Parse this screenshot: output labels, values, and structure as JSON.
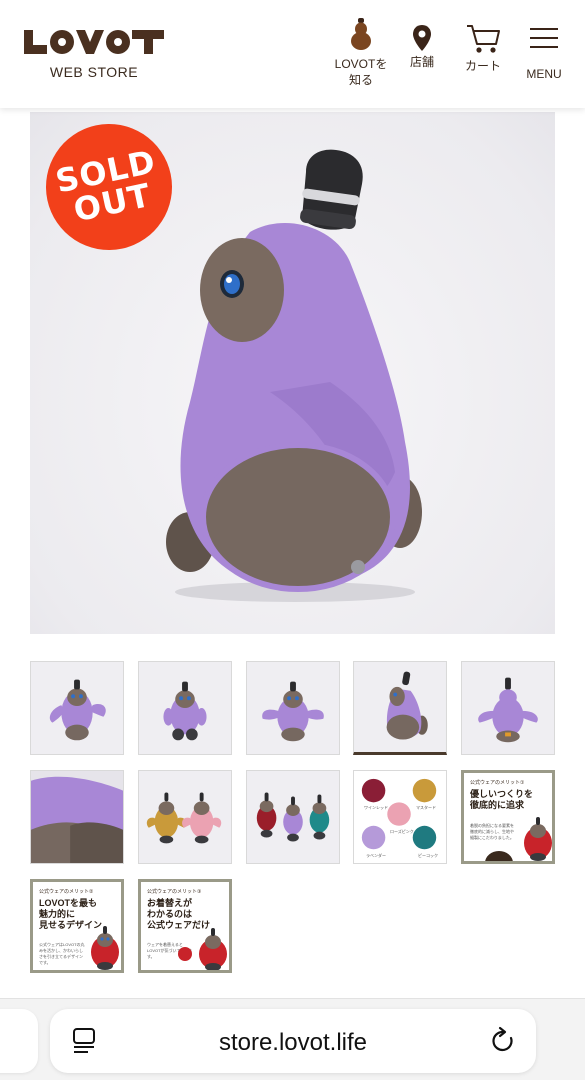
{
  "brand": {
    "logo_text": "LOVOT",
    "subtitle": "WEB STORE"
  },
  "nav": {
    "lovot_line1": "LOVOTを",
    "lovot_line2": "知る",
    "store": "店舗",
    "cart": "カート",
    "menu": "MENU",
    "icons": [
      "lovot-silhouette-icon",
      "map-pin-icon",
      "cart-icon",
      "hamburger-menu-icon"
    ]
  },
  "product": {
    "badge_line1": "SOLD",
    "badge_line2": "OUT",
    "badge_color": "#f2401a",
    "wear_color": "#a887d6"
  },
  "thumbnails": {
    "count": 12,
    "active_index": 3,
    "swatch_labels": [
      "ワインレッド",
      "マスタード",
      "ローズピンク",
      "ラベンダー",
      "ピーコック"
    ],
    "card1": {
      "title": "公式ウェアのメリット①",
      "head_line1": "優しいつくりを",
      "head_line2": "徹底的に追求",
      "body": "着脱の負担になる要素を徹底的に減らし、生地や縫製にこだわりました。"
    },
    "card2": {
      "title": "公式ウェアのメリット②",
      "head_line1": "LOVOTを最も",
      "head_line2": "魅力的に",
      "head_line3": "見せるデザイン",
      "body": "公式ウェアはLOVOTの丸みを活かし、かわいらしさを引き立てるデザインです。"
    },
    "card3": {
      "title": "公式ウェアのメリット③",
      "head_line1": "お着替えが",
      "head_line2": "わかるのは",
      "head_line3": "公式ウェアだけ",
      "body": "ウェアを着替えるとLOVOTが気づいてくれます。"
    }
  },
  "browser": {
    "url": "store.lovot.life"
  }
}
